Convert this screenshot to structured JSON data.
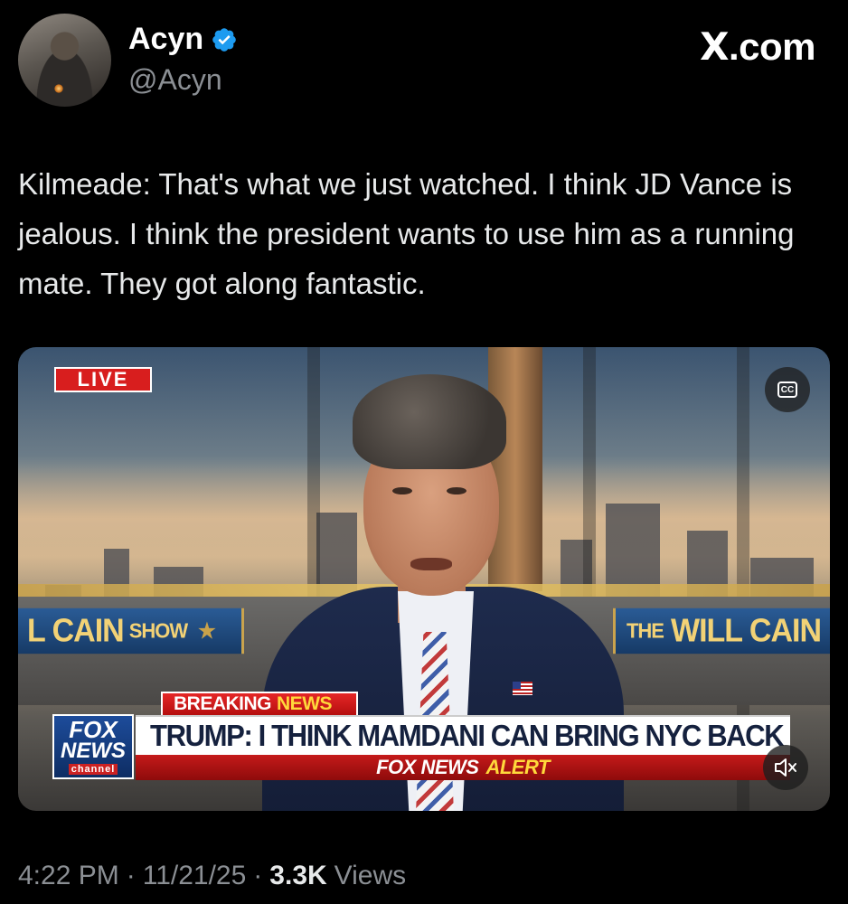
{
  "author": {
    "display_name": "Acyn",
    "handle": "@Acyn",
    "verified": true,
    "verified_color": "#1d9bf0"
  },
  "site_label": "X.com",
  "tweet": {
    "text": "Kilmeade: That's what we just watched. I think JD Vance is jealous. I think the president wants to use him as a running mate. They got along fantastic."
  },
  "media": {
    "live_badge": "LIVE",
    "cc_label": "CC",
    "show_banner_left_main": "L CAIN",
    "show_banner_left_small": "SHOW",
    "show_banner_right_small": "THE",
    "show_banner_right_main": "WILL CAIN",
    "breaking_word1": "BREAKING",
    "breaking_word2": "NEWS",
    "logo_fox": "FOX",
    "logo_news": "NEWS",
    "logo_channel": "channel",
    "headline": "TRUMP: I THINK MAMDANI CAN BRING NYC BACK",
    "alert_part1": "FOX NEWS",
    "alert_part2": "ALERT"
  },
  "meta": {
    "time": "4:22 PM",
    "sep1": "·",
    "date": "11/21/25",
    "sep2": "·",
    "views_count": "3.3K",
    "views_label": "Views"
  },
  "icons": {
    "verified": "verified-badge-icon",
    "cc": "closed-captions-icon",
    "mute": "speaker-muted-icon"
  }
}
